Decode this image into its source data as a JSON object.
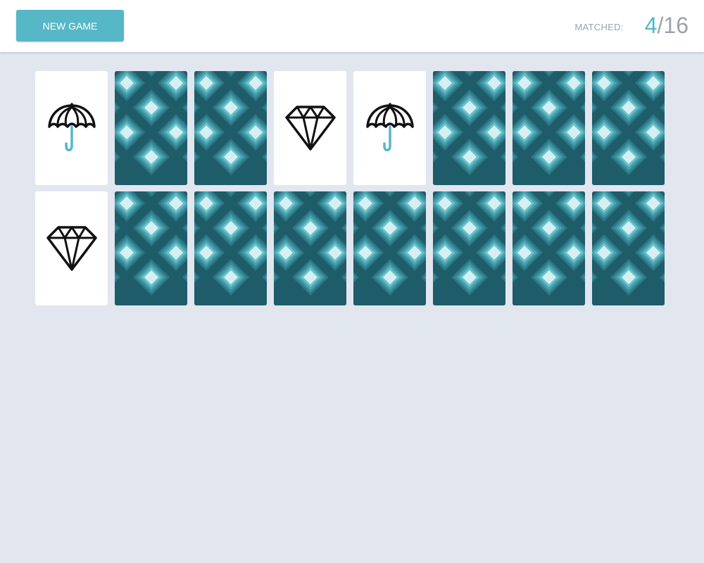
{
  "header": {
    "new_game_label": "New Game",
    "matched_label": "Matched:",
    "matched_count": "4",
    "separator": "/",
    "total": "16"
  },
  "colors": {
    "accent": "#56b7c6",
    "card_back_dark": "#1e5c69",
    "card_back_light": "#d4f0f3",
    "background": "#e2e6ef"
  },
  "board": {
    "rows": 2,
    "cols": 8,
    "cards": [
      {
        "state": "face-up",
        "symbol": "umbrella-icon"
      },
      {
        "state": "face-down"
      },
      {
        "state": "face-down"
      },
      {
        "state": "face-up",
        "symbol": "diamond-icon"
      },
      {
        "state": "face-up",
        "symbol": "umbrella-icon"
      },
      {
        "state": "face-down"
      },
      {
        "state": "face-down"
      },
      {
        "state": "face-down"
      },
      {
        "state": "face-up",
        "symbol": "diamond-icon"
      },
      {
        "state": "face-down"
      },
      {
        "state": "face-down"
      },
      {
        "state": "face-down"
      },
      {
        "state": "face-down"
      },
      {
        "state": "face-down"
      },
      {
        "state": "face-down"
      },
      {
        "state": "face-down"
      }
    ]
  }
}
